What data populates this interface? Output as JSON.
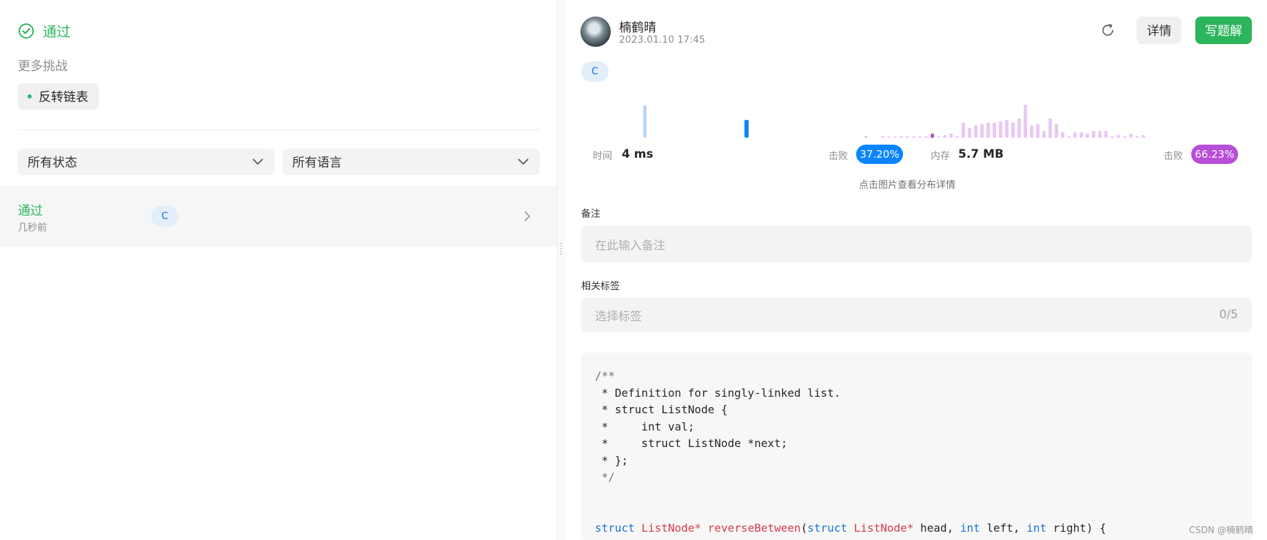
{
  "left": {
    "status": "通过",
    "more_title": "更多挑战",
    "challenge": "反转链表",
    "filter_status": "所有状态",
    "filter_language": "所有语言",
    "submission": {
      "status": "通过",
      "time": "几秒前",
      "language": "C"
    }
  },
  "right": {
    "user": {
      "name": "楠鹤晴",
      "date": "2023.01.10 17:45"
    },
    "buttons": {
      "detail": "详情",
      "write_solution": "写题解"
    },
    "language": "C",
    "runtime": {
      "label": "时间",
      "value": "4 ms",
      "beat_label": "击败",
      "beat": "37.20%"
    },
    "memory": {
      "label": "内存",
      "value": "5.7 MB",
      "beat_label": "击败",
      "beat": "66.23%"
    },
    "hint": "点击图片查看分布详情",
    "memo": {
      "label": "备注",
      "placeholder": "在此输入备注"
    },
    "tags": {
      "label": "相关标签",
      "placeholder": "选择标签",
      "count": "0/5"
    },
    "code_lines": [
      "/**",
      " * Definition for singly-linked list.",
      " * struct ListNode {",
      " *     int val;",
      " *     struct ListNode *next;",
      " * };",
      " */",
      "",
      ""
    ],
    "code_signature": {
      "kw1": "struct",
      "ty1": "ListNode",
      "star1": "*",
      "fn": "reverseBetween",
      "paren": "(",
      "kw2": "struct",
      "ty2": "ListNode",
      "star2": "*",
      "p1": " head, ",
      "kw3": "int",
      "p2": " left, ",
      "kw4": "int",
      "p3": " right) {"
    }
  },
  "watermark": "CSDN @楠鹤晴",
  "colors": {
    "accent_green": "#2db55d",
    "beat_blue": "#0a84ff",
    "beat_purple": "#b64ed8",
    "lang_pill_text": "#1a73d9"
  },
  "icons": {
    "status": "check-circle-icon",
    "select": "chevron-down-icon",
    "row": "chevron-right-icon",
    "refresh": "refresh-icon"
  }
}
